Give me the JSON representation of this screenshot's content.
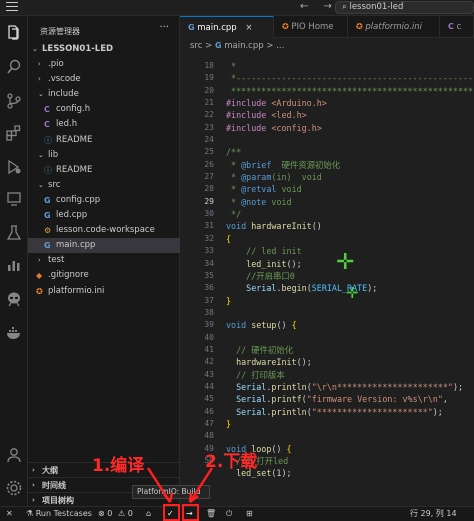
{
  "titlebar": {
    "search_text": "lesson01-led",
    "nav": "← →"
  },
  "activity_icons": [
    "explorer-icon",
    "search-icon",
    "source-control-icon",
    "extensions-icon",
    "run-debug-icon",
    "remote-icon",
    "testing-icon",
    "chart-icon",
    "platformio-alien-icon",
    "docker-icon",
    "account-icon",
    "settings-icon"
  ],
  "sidebar": {
    "title": "资源管理器",
    "more": "···",
    "tree": [
      {
        "label": "LESSON01-LED",
        "depth": 0,
        "kind": "root"
      },
      {
        "label": ".pio",
        "depth": 1,
        "kind": "folder-closed"
      },
      {
        "label": ".vscode",
        "depth": 1,
        "kind": "folder-closed"
      },
      {
        "label": "include",
        "depth": 1,
        "kind": "folder-open"
      },
      {
        "label": "config.h",
        "depth": 2,
        "kind": "h",
        "icon": "C"
      },
      {
        "label": "led.h",
        "depth": 2,
        "kind": "h",
        "icon": "C"
      },
      {
        "label": "README",
        "depth": 2,
        "kind": "info",
        "icon": "ⓘ"
      },
      {
        "label": "lib",
        "depth": 1,
        "kind": "folder-open"
      },
      {
        "label": "README",
        "depth": 2,
        "kind": "info",
        "icon": "ⓘ"
      },
      {
        "label": "src",
        "depth": 1,
        "kind": "folder-open"
      },
      {
        "label": "config.cpp",
        "depth": 2,
        "kind": "cpp",
        "icon": "G"
      },
      {
        "label": "led.cpp",
        "depth": 2,
        "kind": "cpp",
        "icon": "G"
      },
      {
        "label": "lesson.code-workspace",
        "depth": 2,
        "kind": "ws",
        "icon": "⚙"
      },
      {
        "label": "main.cpp",
        "depth": 2,
        "kind": "cpp",
        "icon": "G",
        "active": true
      },
      {
        "label": "test",
        "depth": 1,
        "kind": "folder-closed"
      },
      {
        "label": ".gitignore",
        "depth": 1,
        "kind": "git",
        "icon": "◆"
      },
      {
        "label": "platformio.ini",
        "depth": 1,
        "kind": "pio",
        "icon": "✪"
      }
    ],
    "bottom_sections": [
      "大纲",
      "时间线",
      "项目树构"
    ]
  },
  "tabs": [
    {
      "label": "main.cpp",
      "icon": "G",
      "active": true,
      "close": "×"
    },
    {
      "label": "PIO Home",
      "icon": "✪",
      "active": false
    },
    {
      "label": "platformio.ini",
      "icon": "✪",
      "active": false
    },
    {
      "label": "c",
      "icon": "C",
      "active": false
    }
  ],
  "breadcrumb": {
    "folder": "src",
    "sep": ">",
    "file": "main.cpp",
    "more": "> ..."
  },
  "editor": {
    "current_line": 29,
    "line_numbers": [
      18,
      19,
      20,
      21,
      22,
      23,
      24,
      25,
      26,
      27,
      28,
      29,
      30,
      31,
      32,
      33,
      34,
      35,
      36,
      37,
      38,
      39,
      40,
      41,
      42,
      43,
      44,
      45,
      46,
      47,
      48,
      49,
      50
    ],
    "lines": [
      " *",
      " *-------------------------------------------------------------",
      " *************************************************************",
      "#include <Arduino.h>",
      "#include <led.h>",
      "#include <config.h>",
      "",
      "/**",
      " * @brief  硬件资源初始化",
      " * @param(in)  void",
      " * @retval void",
      " * @note void",
      " */",
      "void hardwareInit()",
      "{",
      "    // led init",
      "    led_init();",
      "    //开启串口0",
      "    Serial.begin(SERIAL_RATE);",
      "}",
      "",
      "void setup() {",
      "",
      "  // 硬件初始化",
      "  hardwareInit();",
      "  // 打印版本",
      "  Serial.println(\"\\r\\n**********************\");",
      "  Serial.printf(\"firmware Version: v%s\\r\\n\",",
      "  Serial.println(\"**********************\");",
      "}",
      "",
      "void loop() {",
      "  //1 打开led",
      "  led_set(1);"
    ]
  },
  "annotations": {
    "build": "1.编译",
    "upload": "2.下载",
    "tooltip": "PlatformIO: Build"
  },
  "statusbar": {
    "remote": "✕",
    "run_tests": "Run Testcases",
    "errors": "⊗ 0",
    "warnings": "⚠ 0",
    "home": "⌂",
    "build": "✓",
    "upload": "→",
    "clean": "🗑",
    "serial": "⏻",
    "terminal": "⊞",
    "position": "行 29, 列 14"
  },
  "colors": {
    "accent": "#0078d4",
    "annotation_red": "#ff1f1f",
    "cursor_green": "#4cd137"
  }
}
